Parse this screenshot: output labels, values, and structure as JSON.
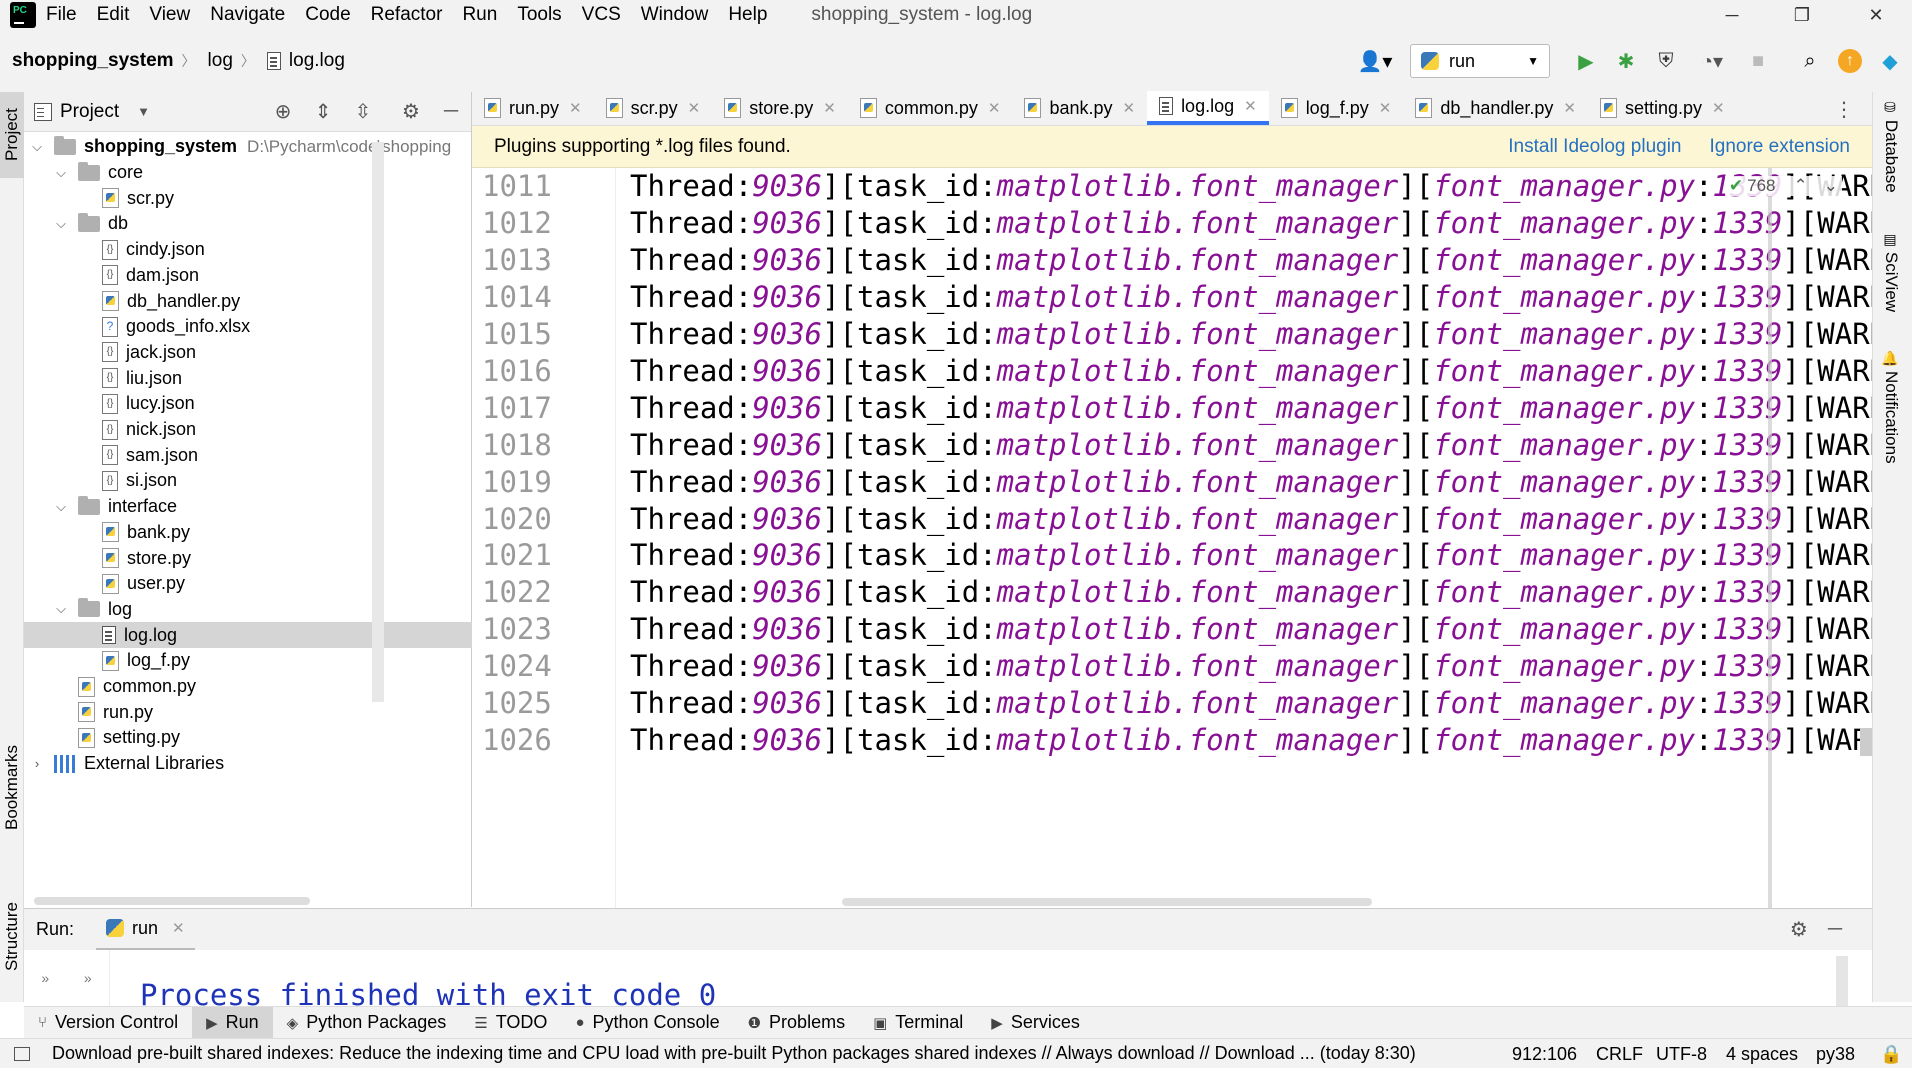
{
  "menu": {
    "items": [
      "File",
      "Edit",
      "View",
      "Navigate",
      "Code",
      "Refactor",
      "Run",
      "Tools",
      "VCS",
      "Window",
      "Help"
    ],
    "window_title": "shopping_system - log.log"
  },
  "window_controls": {
    "minimize": "─",
    "restore": "❐",
    "close": "✕"
  },
  "breadcrumb": {
    "project": "shopping_system",
    "folder": "log",
    "file": "log.log"
  },
  "toolbar": {
    "run_config": "run"
  },
  "left_strip": {
    "project": "Project",
    "bookmarks": "Bookmarks",
    "structure": "Structure"
  },
  "right_strip": {
    "database": "Database",
    "sciview": "SciView",
    "notifications": "Notifications"
  },
  "project_panel": {
    "title": "Project",
    "root": {
      "name": "shopping_system",
      "path": "D:\\Pycharm\\code\\shopping"
    },
    "tree": [
      {
        "name": "core",
        "kind": "folder",
        "depth": 1,
        "expanded": true
      },
      {
        "name": "scr.py",
        "kind": "py",
        "depth": 2
      },
      {
        "name": "db",
        "kind": "folder",
        "depth": 1,
        "expanded": true
      },
      {
        "name": "cindy.json",
        "kind": "json",
        "depth": 2
      },
      {
        "name": "dam.json",
        "kind": "json",
        "depth": 2
      },
      {
        "name": "db_handler.py",
        "kind": "py",
        "depth": 2
      },
      {
        "name": "goods_info.xlsx",
        "kind": "xlsx",
        "depth": 2
      },
      {
        "name": "jack.json",
        "kind": "json",
        "depth": 2
      },
      {
        "name": "liu.json",
        "kind": "json",
        "depth": 2
      },
      {
        "name": "lucy.json",
        "kind": "json",
        "depth": 2
      },
      {
        "name": "nick.json",
        "kind": "json",
        "depth": 2
      },
      {
        "name": "sam.json",
        "kind": "json",
        "depth": 2
      },
      {
        "name": "si.json",
        "kind": "json",
        "depth": 2
      },
      {
        "name": "interface",
        "kind": "folder",
        "depth": 1,
        "expanded": true
      },
      {
        "name": "bank.py",
        "kind": "py",
        "depth": 2
      },
      {
        "name": "store.py",
        "kind": "py",
        "depth": 2
      },
      {
        "name": "user.py",
        "kind": "py",
        "depth": 2
      },
      {
        "name": "log",
        "kind": "folder",
        "depth": 1,
        "expanded": true
      },
      {
        "name": "log.log",
        "kind": "log",
        "depth": 2,
        "selected": true
      },
      {
        "name": "log_f.py",
        "kind": "py",
        "depth": 2
      },
      {
        "name": "common.py",
        "kind": "py",
        "depth": 1
      },
      {
        "name": "run.py",
        "kind": "py",
        "depth": 1
      },
      {
        "name": "setting.py",
        "kind": "py",
        "depth": 1
      }
    ],
    "external_libraries": "External Libraries"
  },
  "editor_tabs": [
    {
      "label": "run.py",
      "active": false
    },
    {
      "label": "scr.py",
      "active": false
    },
    {
      "label": "store.py",
      "active": false
    },
    {
      "label": "common.py",
      "active": false
    },
    {
      "label": "bank.py",
      "active": false
    },
    {
      "label": "log.log",
      "active": true
    },
    {
      "label": "log_f.py",
      "active": false
    },
    {
      "label": "db_handler.py",
      "active": false
    },
    {
      "label": "setting.py",
      "active": false
    }
  ],
  "banner": {
    "message": "Plugins supporting *.log files found.",
    "install_link": "Install Ideolog plugin",
    "ignore_link": "Ignore extension"
  },
  "editor": {
    "inspection_count": "768",
    "line_prefix": "Thread:",
    "thread_id": "9036",
    "task_label": "][task_id:",
    "task_value": "matplotlib.font_manager",
    "file_value": "font_manager.py",
    "line_value": "1339",
    "level_text": "][WARNIN",
    "lines": [
      {
        "num": "1011"
      },
      {
        "num": "1012"
      },
      {
        "num": "1013"
      },
      {
        "num": "1014"
      },
      {
        "num": "1015"
      },
      {
        "num": "1016"
      },
      {
        "num": "1017"
      },
      {
        "num": "1018"
      },
      {
        "num": "1019"
      },
      {
        "num": "1020"
      },
      {
        "num": "1021"
      },
      {
        "num": "1022"
      },
      {
        "num": "1023"
      },
      {
        "num": "1024"
      },
      {
        "num": "1025"
      },
      {
        "num": "1026"
      }
    ]
  },
  "run_panel": {
    "label": "Run:",
    "tab": "run",
    "output": "Process finished with exit code 0"
  },
  "tool_windows": [
    {
      "label": "Version Control",
      "icon": "⑂",
      "active": false
    },
    {
      "label": "Run",
      "icon": "▶",
      "active": true
    },
    {
      "label": "Python Packages",
      "icon": "◈",
      "active": false
    },
    {
      "label": "TODO",
      "icon": "☰",
      "active": false
    },
    {
      "label": "Python Console",
      "icon": "●",
      "active": false
    },
    {
      "label": "Problems",
      "icon": "❶",
      "active": false
    },
    {
      "label": "Terminal",
      "icon": "▣",
      "active": false
    },
    {
      "label": "Services",
      "icon": "▶",
      "active": false
    }
  ],
  "status": {
    "message": "Download pre-built shared indexes: Reduce the indexing time and CPU load with pre-built Python packages shared indexes // Always download // Download ... (today 8:30)",
    "position": "912:106",
    "line_sep": "CRLF",
    "encoding": "UTF-8",
    "indent": "4 spaces",
    "interpreter": "py38"
  },
  "colors": {
    "accent": "#3574f0",
    "italic_value": "#871094",
    "output": "#1e33b7",
    "banner_bg": "#fdf6d4",
    "link": "#2470c2"
  }
}
